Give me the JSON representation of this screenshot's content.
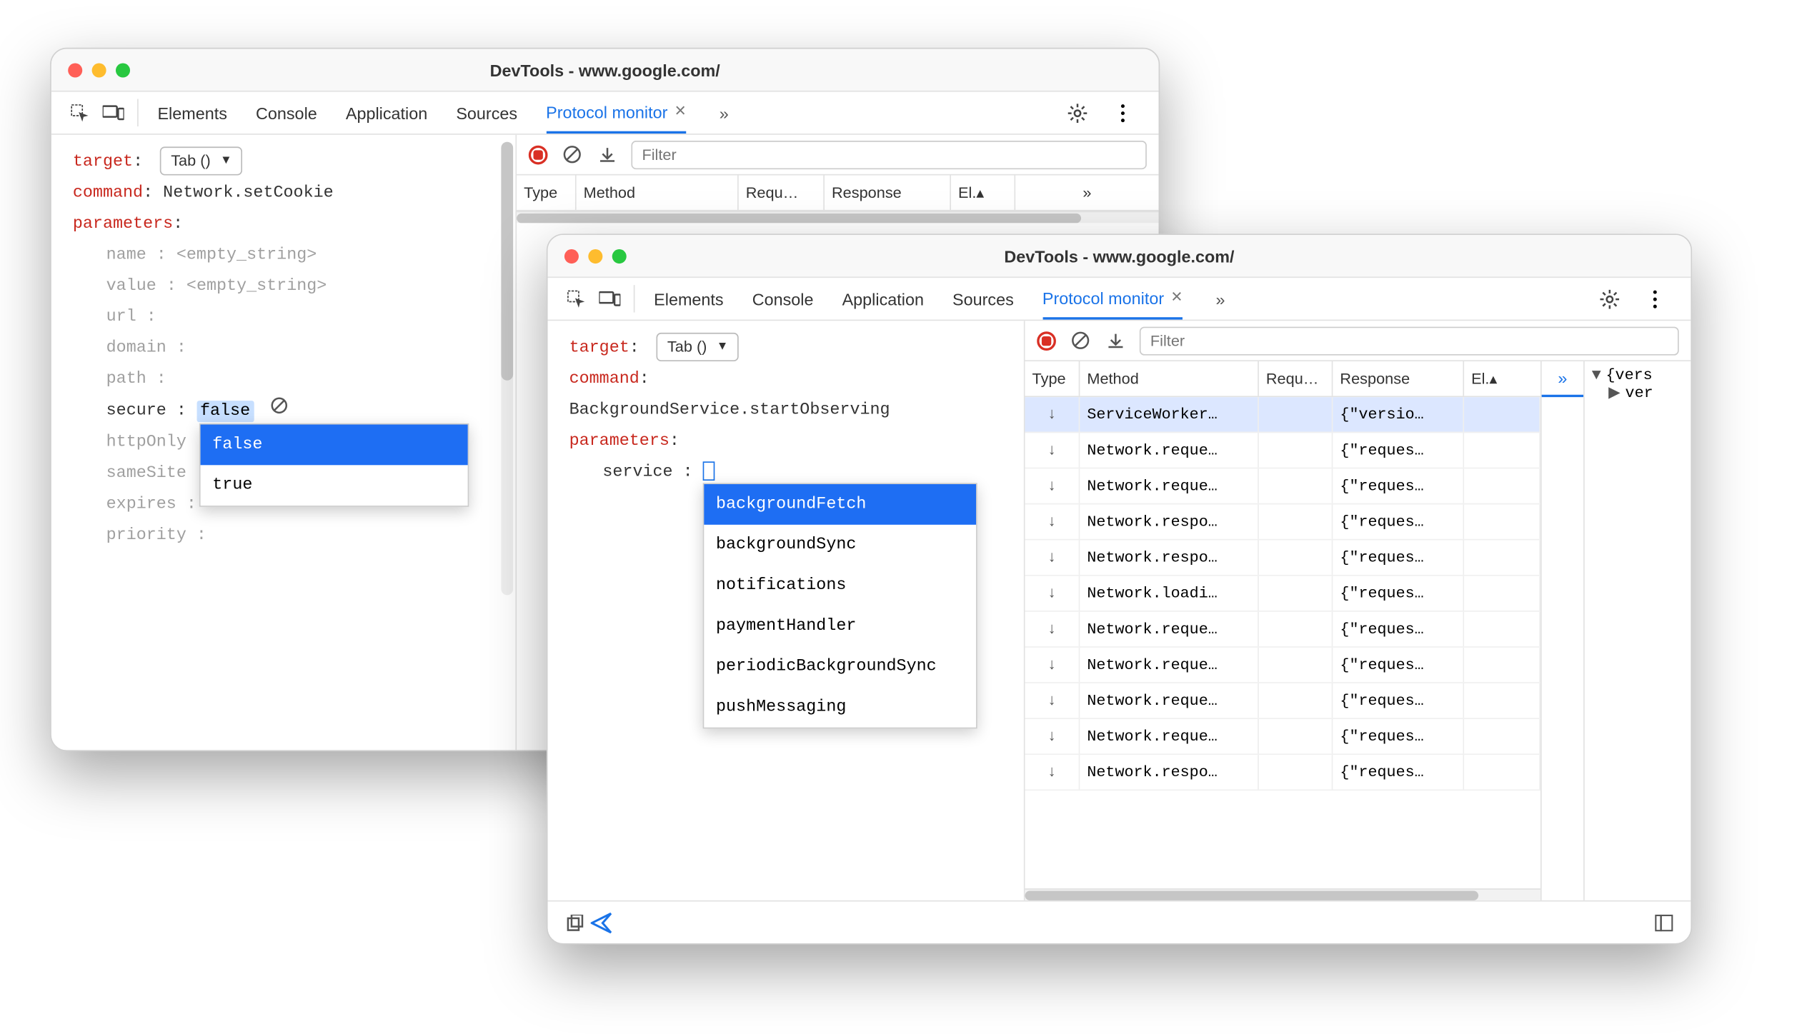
{
  "shared": {
    "title": "DevTools - www.google.com/",
    "tabs": [
      "Elements",
      "Console",
      "Application",
      "Sources",
      "Protocol monitor"
    ],
    "active_tab": "Protocol monitor",
    "filter_placeholder": "Filter",
    "columns": {
      "type": "Type",
      "method": "Method",
      "request": "Requ…",
      "response": "Response",
      "elapsed": "El.▴"
    },
    "target_label": "target",
    "target_select": "Tab ()",
    "command_label": "command",
    "parameters_label": "parameters"
  },
  "winA": {
    "command_value": "Network.setCookie",
    "params": [
      {
        "name": "name",
        "value": "<empty_string>",
        "gray": true
      },
      {
        "name": "value",
        "value": "<empty_string>",
        "gray": true
      },
      {
        "name": "url",
        "value": "",
        "gray": true
      },
      {
        "name": "domain",
        "value": "",
        "gray": true
      },
      {
        "name": "path",
        "value": "",
        "gray": true
      },
      {
        "name": "secure",
        "value": "false",
        "highlight": true
      },
      {
        "name": "httpOnly",
        "value": "",
        "gray": true
      },
      {
        "name": "sameSite",
        "value": "",
        "gray": true
      },
      {
        "name": "expires",
        "value": "",
        "gray": true
      },
      {
        "name": "priority",
        "value": "",
        "gray": true
      }
    ],
    "autocomplete": {
      "selected": "false",
      "options": [
        "false",
        "true"
      ]
    }
  },
  "winB": {
    "command_value": "BackgroundService.startObserving",
    "params": [
      {
        "name": "service",
        "value": ""
      }
    ],
    "autocomplete": {
      "selected": "backgroundFetch",
      "options": [
        "backgroundFetch",
        "backgroundSync",
        "notifications",
        "paymentHandler",
        "periodicBackgroundSync",
        "pushMessaging"
      ]
    },
    "rows": [
      {
        "method": "ServiceWorker…",
        "response": "{\"versio…",
        "selected": true
      },
      {
        "method": "Network.reque…",
        "response": "{\"reques…"
      },
      {
        "method": "Network.reque…",
        "response": "{\"reques…"
      },
      {
        "method": "Network.respo…",
        "response": "{\"reques…"
      },
      {
        "method": "Network.respo…",
        "response": "{\"reques…"
      },
      {
        "method": "Network.loadi…",
        "response": "{\"reques…"
      },
      {
        "method": "Network.reque…",
        "response": "{\"reques…"
      },
      {
        "method": "Network.reque…",
        "response": "{\"reques…"
      },
      {
        "method": "Network.reque…",
        "response": "{\"reques…"
      },
      {
        "method": "Network.reque…",
        "response": "{\"reques…"
      },
      {
        "method": "Network.respo…",
        "response": "{\"reques…"
      }
    ],
    "tree": {
      "root": "{vers",
      "child": "ver"
    }
  }
}
